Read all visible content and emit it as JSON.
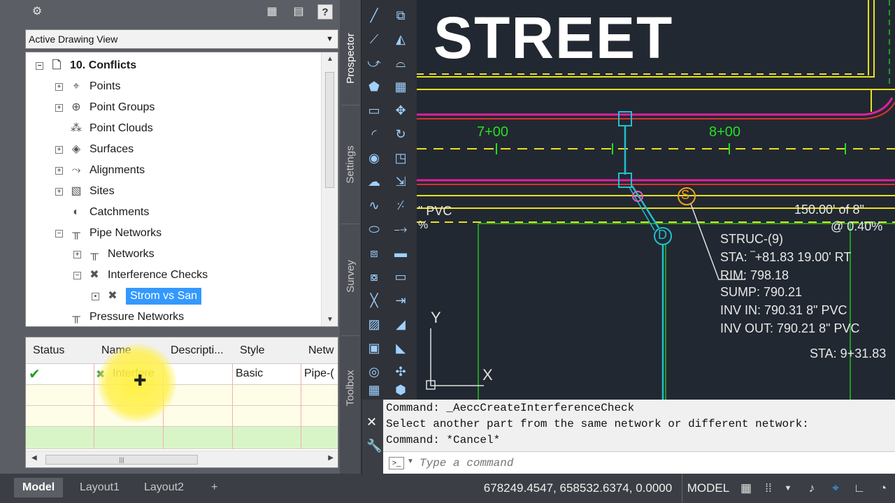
{
  "toolspace": {
    "view_selector": "Active Drawing View",
    "tree": [
      {
        "label": "10. Conflicts",
        "icon": "drawing-icon",
        "bold": true,
        "expander": "−"
      },
      {
        "label": "Points",
        "icon": "point-icon",
        "expander": "+"
      },
      {
        "label": "Point Groups",
        "icon": "point-group-icon",
        "expander": "+"
      },
      {
        "label": "Point Clouds",
        "icon": "point-cloud-icon",
        "expander": ""
      },
      {
        "label": "Surfaces",
        "icon": "surface-icon",
        "expander": "+"
      },
      {
        "label": "Alignments",
        "icon": "alignment-icon",
        "expander": "+"
      },
      {
        "label": "Sites",
        "icon": "site-icon",
        "expander": "+"
      },
      {
        "label": "Catchments",
        "icon": "catchment-icon",
        "expander": ""
      },
      {
        "label": "Pipe Networks",
        "icon": "pipe-network-icon",
        "expander": "−"
      },
      {
        "label": "Networks",
        "icon": "pipe-network-icon",
        "expander": "+"
      },
      {
        "label": "Interference Checks",
        "icon": "interference-icon",
        "expander": "−"
      },
      {
        "label": "Strom vs San",
        "icon": "interference-icon",
        "expander": "•",
        "selected": true
      },
      {
        "label": "Pressure Networks",
        "icon": "pressure-network-icon",
        "expander": ""
      }
    ],
    "grid": {
      "columns": [
        "Status",
        "Name",
        "Descripti...",
        "Style",
        "Netw"
      ],
      "rows": [
        {
          "status": "✔",
          "name": "Interfere",
          "style": "Basic",
          "network": "Pipe-("
        }
      ]
    }
  },
  "vertical_tabs": [
    "Prospector",
    "Settings",
    "Survey",
    "Toolbox"
  ],
  "drawing": {
    "street_label": "STREET",
    "stations": [
      "7+00",
      "8+00"
    ],
    "pipe_left": "\" PVC",
    "pipe_left_pct": "%",
    "pipe_right": "150.00' of 8\"",
    "pipe_right_slope": "@ 0.40%",
    "structure_s": "S",
    "structure_d": "D",
    "struc_label": {
      "name": "STRUC-(9)",
      "sta": "STA: ‾+81.83    19.00' RT",
      "rim": "RIM: 798.18",
      "sump": "SUMP: 790.21",
      "inv_in": "INV IN: 790.31  8\"  PVC",
      "inv_out": "INV OUT: 790.21  8\"  PVC"
    },
    "sta_right": "STA: 9+31.83",
    "ucs_y": "Y",
    "ucs_x": "X"
  },
  "command": {
    "history": [
      "Command: _AeccCreateInterferenceCheck",
      "Select another part from the same network or different network:",
      "Command: *Cancel*"
    ],
    "placeholder": "Type a command"
  },
  "status_bar": {
    "layout_tabs": [
      "Model",
      "Layout1",
      "Layout2"
    ],
    "add_tab": "+",
    "coordinates": "678249.4547, 658532.6374, 0.0000",
    "space": "MODEL"
  },
  "colors": {
    "panel": "#5b5e64",
    "drawing_bg": "#222831",
    "selection": "#3399ff",
    "green_text": "#22e022",
    "magenta_line": "#e020a0",
    "cyan_pipe": "#20c0d0"
  }
}
